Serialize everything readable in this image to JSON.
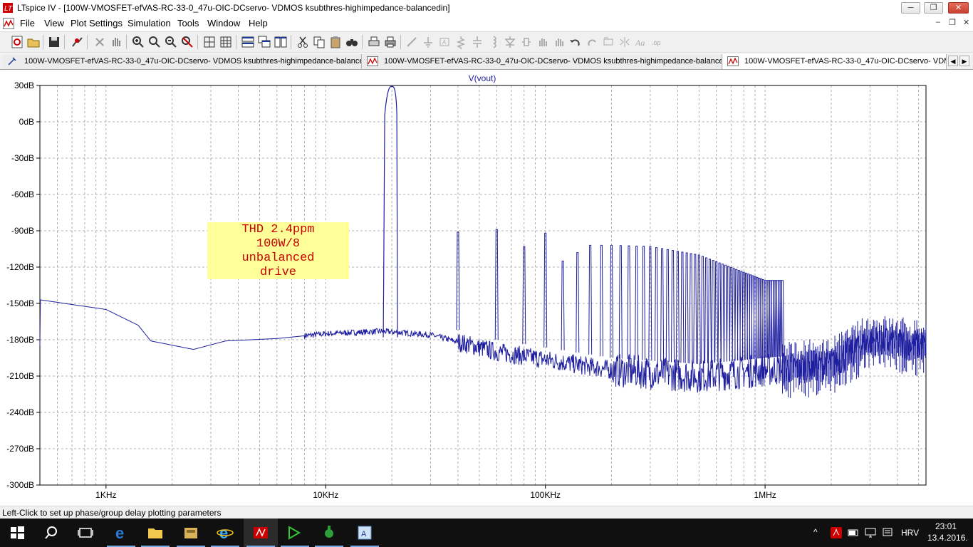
{
  "window": {
    "title": "LTspice IV - [100W-VMOSFET-efVAS-RC-33-0_47u-OIC-DCservo- VDMOS ksubthres-highimpedance-balancedin]",
    "minimize": "─",
    "maximize": "❐",
    "close": "✕"
  },
  "menu": {
    "items": [
      "File",
      "View",
      "Plot Settings",
      "Simulation",
      "Tools",
      "Window",
      "Help"
    ],
    "mdi_minimize": "–",
    "mdi_restore": "❐",
    "mdi_close": "✕"
  },
  "toolbar": {
    "icons": [
      "new-schematic",
      "open",
      "save",
      "control-panel",
      "halt",
      "pan",
      "zoom-in",
      "zoom-area",
      "zoom-out",
      "zoom-fit",
      "autorange",
      "tile-horizontal",
      "tile-vertical",
      "cascade",
      "cut",
      "copy",
      "paste",
      "find",
      "print-preview",
      "print",
      "wire",
      "ground",
      "label",
      "resistor",
      "capacitor",
      "inductor",
      "diode",
      "component",
      "move",
      "drag",
      "undo",
      "redo",
      "rotate",
      "mirror",
      "text",
      "spice-directive"
    ]
  },
  "tabs": [
    {
      "label": "100W-VMOSFET-efVAS-RC-33-0_47u-OIC-DCservo- VDMOS ksubthres-highimpedance-balancedin",
      "icon": "schematic-icon",
      "active": false
    },
    {
      "label": "100W-VMOSFET-efVAS-RC-33-0_47u-OIC-DCservo- VDMOS ksubthres-highimpedance-balancedin",
      "icon": "waveform-icon",
      "active": false
    },
    {
      "label": "100W-VMOSFET-efVAS-RC-33-0_47u-OIC-DCservo- VDMOS ksubthres-highimpedance-balancedin",
      "icon": "waveform-icon",
      "active": true
    }
  ],
  "plot": {
    "trace_name": "V(vout)",
    "annotation": [
      "THD 2.4ppm",
      "100W/8",
      "unbalanced",
      "drive"
    ]
  },
  "chart_data": {
    "type": "line",
    "title": "V(vout)",
    "xscale": "log",
    "xlim": [
      500,
      5400000
    ],
    "ylim": [
      -300,
      30
    ],
    "y_ticks": [
      "30dB",
      "0dB",
      "-30dB",
      "-60dB",
      "-90dB",
      "-120dB",
      "-150dB",
      "-180dB",
      "-210dB",
      "-240dB",
      "-270dB",
      "-300dB"
    ],
    "y_tick_values": [
      30,
      0,
      -30,
      -60,
      -90,
      -120,
      -150,
      -180,
      -210,
      -240,
      -270,
      -300
    ],
    "x_ticks": [
      "1KHz",
      "10KHz",
      "100KHz",
      "1MHz"
    ],
    "x_tick_values": [
      1000,
      10000,
      100000,
      1000000
    ],
    "grid": true,
    "trace_color": "#1f1fa0",
    "series": [
      {
        "name": "V(vout)",
        "fundamental_hz": 20000,
        "fundamental_db": 29,
        "harmonics": [
          {
            "hz": 40000,
            "db": -91
          },
          {
            "hz": 60000,
            "db": -89
          },
          {
            "hz": 80000,
            "db": -103
          },
          {
            "hz": 100000,
            "db": -92
          },
          {
            "hz": 120000,
            "db": -115
          },
          {
            "hz": 160000,
            "db": -102
          },
          {
            "hz": 200000,
            "db": -102
          },
          {
            "hz": 300000,
            "db": -103
          },
          {
            "hz": 500000,
            "db": -110
          },
          {
            "hz": 1000000,
            "db": -131
          }
        ],
        "noise_floor": [
          {
            "hz": 500,
            "db": -147
          },
          {
            "hz": 1000,
            "db": -155
          },
          {
            "hz": 1400,
            "db": -168
          },
          {
            "hz": 1600,
            "db": -181
          },
          {
            "hz": 2500,
            "db": -188
          },
          {
            "hz": 3500,
            "db": -181
          },
          {
            "hz": 6000,
            "db": -179
          },
          {
            "hz": 10000,
            "db": -175
          },
          {
            "hz": 18000,
            "db": -173
          },
          {
            "hz": 30000,
            "db": -176
          },
          {
            "hz": 60000,
            "db": -190
          },
          {
            "hz": 200000,
            "db": -205
          },
          {
            "hz": 500000,
            "db": -210
          },
          {
            "hz": 1000000,
            "db": -205
          },
          {
            "hz": 2000000,
            "db": -200
          },
          {
            "hz": 3000000,
            "db": -180
          },
          {
            "hz": 5400000,
            "db": -185
          }
        ]
      }
    ]
  },
  "status": {
    "text": "Left-Click to set up phase/group delay plotting parameters"
  },
  "taskbar": {
    "apps": [
      "start-icon",
      "search-icon",
      "task-view-icon",
      "edge-icon",
      "file-explorer-icon",
      "folder-icon",
      "internet-explorer-icon",
      "ltspice-icon",
      "ltspice-alt-icon",
      "network-icon",
      "app-icon"
    ],
    "language": "HRV",
    "time": "23:01",
    "date": "13.4.2016."
  }
}
